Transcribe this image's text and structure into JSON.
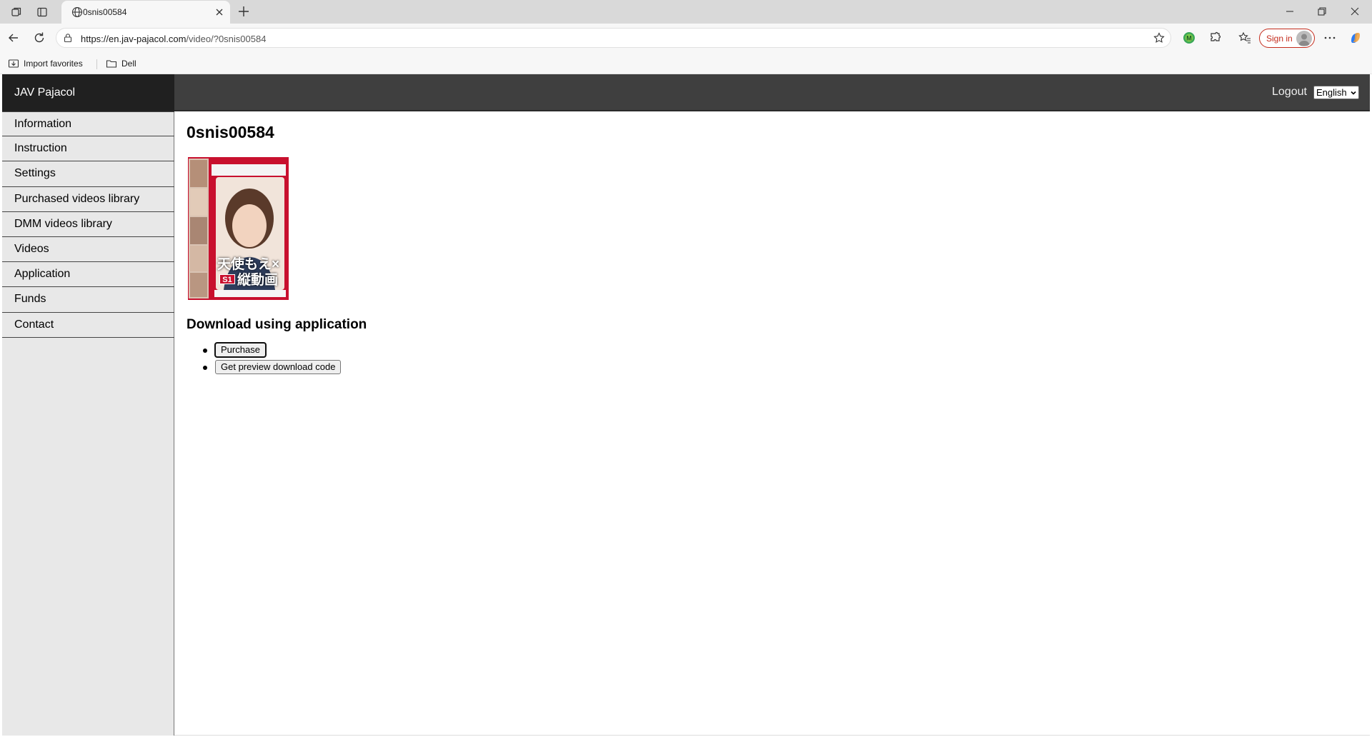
{
  "browser": {
    "tab_title": "0snis00584",
    "url_host": "https://en.jav-pajacol.com",
    "url_path": "/video/?0snis00584",
    "signin_label": "Sign in",
    "favorites": [
      {
        "label": "Import favorites",
        "icon": "import-favorites-icon"
      },
      {
        "label": "Dell",
        "icon": "folder-icon"
      }
    ]
  },
  "site": {
    "brand": "JAV Pajacol",
    "logout_label": "Logout",
    "language": "English",
    "menu": [
      "Information",
      "Instruction",
      "Settings",
      "Purchased videos library",
      "DMM videos library",
      "Videos",
      "Application",
      "Funds",
      "Contact"
    ]
  },
  "video": {
    "title": "0snis00584",
    "cover_text_line1": "天使もえ×",
    "cover_text_line2": "縦動画",
    "cover_logo": "S1",
    "download_heading": "Download using application",
    "buttons": [
      "Purchase",
      "Get preview download code"
    ]
  },
  "colors": {
    "header_bg": "#3f3f3f",
    "brand_bg": "#202020",
    "sidebar_bg": "#e8e8e8",
    "signin_accent": "#c42b1c",
    "cover_red": "#c8102e"
  }
}
